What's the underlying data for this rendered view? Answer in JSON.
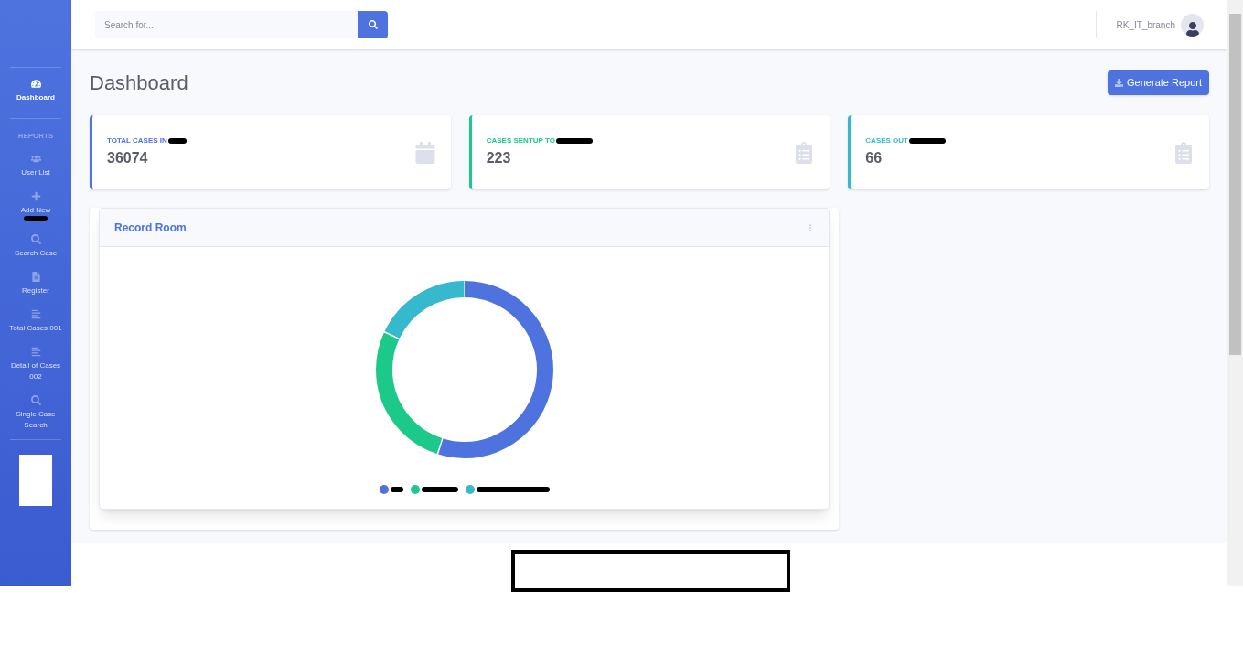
{
  "sidebar": {
    "items": [
      {
        "kind": "link",
        "label": "Dashboard",
        "selected": true
      },
      {
        "kind": "heading",
        "label": "REPORTS"
      },
      {
        "kind": "link",
        "label": "User List",
        "selected": false
      },
      {
        "kind": "link",
        "label": "Add New",
        "redacted": true,
        "selected": false
      },
      {
        "kind": "link",
        "label": "Search Case",
        "selected": false
      },
      {
        "kind": "link",
        "label": "Register",
        "selected": false
      },
      {
        "kind": "link",
        "label": "Total Cases 001",
        "selected": false
      },
      {
        "kind": "link",
        "label": "Detail of Cases 002",
        "selected": false
      },
      {
        "kind": "link",
        "label": "Single Case Search",
        "selected": false
      }
    ]
  },
  "topbar": {
    "search": {
      "placeholder": "Search for..."
    },
    "user": "RK_IT_branch"
  },
  "page": {
    "title": "Dashboard",
    "button": "Generate Report"
  },
  "cards": [
    {
      "label": "TOTAL CASES IN",
      "value": "36074",
      "color": "#4e73df"
    },
    {
      "label": "CASES SENTUP TO",
      "value": "223",
      "color": "#1cc88a"
    },
    {
      "label": "CASES OUT",
      "value": "66",
      "color": "#36b9cc"
    }
  ],
  "panel": {
    "title": "Record Room",
    "legend": [
      {
        "color": "#4e73df"
      },
      {
        "color": "#1cc88a"
      },
      {
        "color": "#36b9cc"
      }
    ]
  }
}
